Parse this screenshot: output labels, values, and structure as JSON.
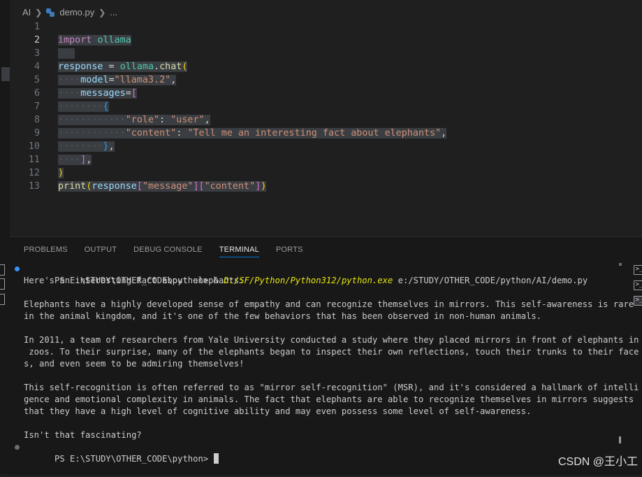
{
  "breadcrumb": {
    "folder": "AI",
    "file": "demo.py",
    "more": "..."
  },
  "editor": {
    "active_line": "2",
    "lines": [
      {
        "n": "1"
      },
      {
        "n": "2",
        "t": [
          [
            "kw",
            "import"
          ],
          [
            "op",
            " "
          ],
          [
            "mod",
            "ollama"
          ]
        ]
      },
      {
        "n": "3"
      },
      {
        "n": "4",
        "t": [
          [
            "var",
            "response"
          ],
          [
            "op",
            " = "
          ],
          [
            "mod",
            "ollama"
          ],
          [
            "op",
            "."
          ],
          [
            "fn",
            "chat"
          ],
          [
            "b1",
            "("
          ]
        ]
      },
      {
        "n": "5",
        "t": [
          [
            "ws",
            "····"
          ],
          [
            "var",
            "model"
          ],
          [
            "op",
            "="
          ],
          [
            "str",
            "\"llama3.2\""
          ],
          [
            "op",
            ","
          ]
        ]
      },
      {
        "n": "6",
        "t": [
          [
            "ws",
            "····"
          ],
          [
            "var",
            "messages"
          ],
          [
            "op",
            "="
          ],
          [
            "b2",
            "["
          ]
        ]
      },
      {
        "n": "7",
        "t": [
          [
            "ws",
            "········"
          ],
          [
            "b3",
            "{"
          ]
        ]
      },
      {
        "n": "8",
        "t": [
          [
            "ws",
            "············"
          ],
          [
            "str",
            "\"role\""
          ],
          [
            "op",
            ": "
          ],
          [
            "str",
            "\"user\""
          ],
          [
            "op",
            ","
          ]
        ]
      },
      {
        "n": "9",
        "t": [
          [
            "ws",
            "············"
          ],
          [
            "str",
            "\"content\""
          ],
          [
            "op",
            ": "
          ],
          [
            "str",
            "\"Tell me an interesting fact about elephants\""
          ],
          [
            "op",
            ","
          ]
        ]
      },
      {
        "n": "10",
        "t": [
          [
            "ws",
            "········"
          ],
          [
            "b3",
            "}"
          ],
          [
            "op",
            ","
          ]
        ]
      },
      {
        "n": "11",
        "t": [
          [
            "ws",
            "····"
          ],
          [
            "b2",
            "]"
          ],
          [
            "op",
            ","
          ]
        ]
      },
      {
        "n": "12",
        "t": [
          [
            "b1",
            ")"
          ]
        ]
      },
      {
        "n": "13",
        "t": [
          [
            "fn",
            "print"
          ],
          [
            "b1",
            "("
          ],
          [
            "var",
            "response"
          ],
          [
            "b2",
            "["
          ],
          [
            "str",
            "\"message\""
          ],
          [
            "b2",
            "]["
          ],
          [
            "str",
            "\"content\""
          ],
          [
            "b2",
            "]"
          ],
          [
            "b1",
            ")"
          ]
        ]
      }
    ]
  },
  "panel": {
    "tabs": [
      {
        "label": "PROBLEMS",
        "active": false
      },
      {
        "label": "OUTPUT",
        "active": false
      },
      {
        "label": "DEBUG CONSOLE",
        "active": false
      },
      {
        "label": "TERMINAL",
        "active": true
      },
      {
        "label": "PORTS",
        "active": false
      }
    ]
  },
  "terminal": {
    "prompt": "PS E:\\STUDY\\OTHER_CODE\\python> ",
    "command_prefix": "& ",
    "exe_path": "D:/SF/Python/Python312/python.exe",
    "script_path": " e:/STUDY/OTHER_CODE/python/AI/demo.py",
    "output": [
      "Here's an interesting fact about elephants:",
      "",
      "Elephants have a highly developed sense of empathy and can recognize themselves in mirrors. This self-awareness is rare",
      "in the animal kingdom, and it's one of the few behaviors that has been observed in non-human animals.",
      "",
      "In 2011, a team of researchers from Yale University conducted a study where they placed mirrors in front of elephants in",
      " zoos. To their surprise, many of the elephants began to inspect their own reflections, touch their trunks to their face",
      "s, and even seem to be admiring themselves!",
      "",
      "This self-recognition is often referred to as \"mirror self-recognition\" (MSR), and it's considered a hallmark of intelli",
      "gence and emotional complexity in animals. The fact that elephants are able to recognize themselves in mirrors suggests",
      "that they have a high level of cognitive ability and may even possess some level of self-awareness.",
      "",
      "Isn't that fascinating?"
    ],
    "final_prompt": "PS E:\\STUDY\\OTHER_CODE\\python> ",
    "colors": {
      "dot_done": "#3794ff",
      "dot_idle": "#6e6e6e",
      "exe": "#e5e510"
    }
  },
  "watermark": "CSDN @王小工"
}
